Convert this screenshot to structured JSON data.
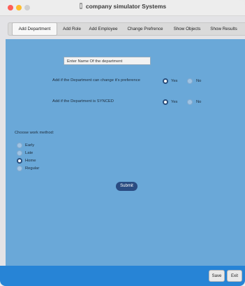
{
  "window": {
    "title": "company simulator Systems"
  },
  "tabs": [
    {
      "label": "Add Department",
      "active": true
    },
    {
      "label": "Add Role",
      "active": false
    },
    {
      "label": "Add Employee",
      "active": false
    },
    {
      "label": "Change Prefrence",
      "active": false
    },
    {
      "label": "Show Objects",
      "active": false
    },
    {
      "label": "Show Results",
      "active": false
    }
  ],
  "form": {
    "department_name": "Enter Name Of the department",
    "q_preference": "Add if the Department can change it's preference",
    "q_synced": "Add if the Department is SYNCED",
    "yes": "Yes",
    "no": "No",
    "preference_selected": "Yes",
    "synced_selected": "Yes",
    "work_method_label": "Choose work method:",
    "work_methods": [
      "Early",
      "Late",
      "Home",
      "Regular"
    ],
    "work_method_selected": "Home",
    "submit": "Submit"
  },
  "footer": {
    "save": "Save",
    "exit": "Exit"
  },
  "colors": {
    "panel": "#6aa8d8",
    "footer": "#2784d6",
    "submit": "#2a4c82"
  }
}
